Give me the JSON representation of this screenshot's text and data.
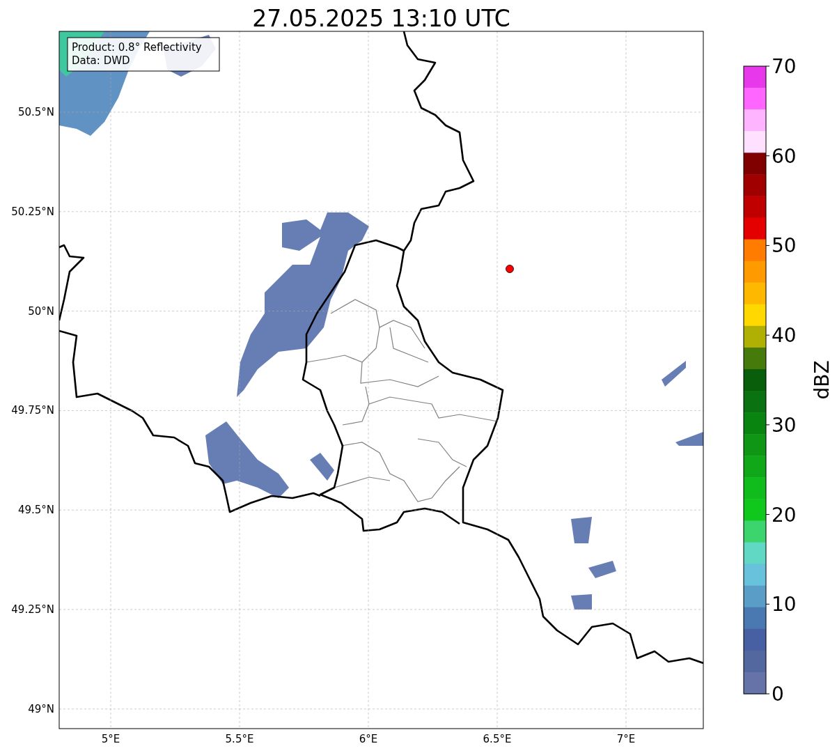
{
  "title": "27.05.2025 13:10 UTC",
  "map": {
    "x_labels": [
      "5°E",
      "5.5°E",
      "6°E",
      "6.5°E",
      "7°E"
    ],
    "y_labels": [
      "50.5°N",
      "50.25°N",
      "50°N",
      "49.75°N",
      "49.5°N",
      "49.25°N",
      "49°N"
    ]
  },
  "info_box": {
    "lines": [
      "Product: 0.8° Reflectivity",
      "Data: DWD"
    ]
  },
  "colorbar": {
    "label": "dBZ",
    "ticks": [
      "70",
      "60",
      "50",
      "40",
      "30",
      "20",
      "10",
      "0"
    ],
    "bins": [
      {
        "color": "#e838ec"
      },
      {
        "color": "#ff66ff"
      },
      {
        "color": "#ffb4ff"
      },
      {
        "color": "#ffe0ff"
      },
      {
        "color": "#800000"
      },
      {
        "color": "#a00000"
      },
      {
        "color": "#c00000"
      },
      {
        "color": "#e40000"
      },
      {
        "color": "#ff7c00"
      },
      {
        "color": "#ff9a00"
      },
      {
        "color": "#ffb800"
      },
      {
        "color": "#ffd800"
      },
      {
        "color": "#b0b004"
      },
      {
        "color": "#467a0a"
      },
      {
        "color": "#085e0a"
      },
      {
        "color": "#0a7210"
      },
      {
        "color": "#0a8410"
      },
      {
        "color": "#0e9614"
      },
      {
        "color": "#10a818"
      },
      {
        "color": "#10bc1c"
      },
      {
        "color": "#10c81c"
      },
      {
        "color": "#3cd46c"
      },
      {
        "color": "#60d8c4"
      },
      {
        "color": "#68c2dc"
      },
      {
        "color": "#5a9ec8"
      },
      {
        "color": "#4a78b0"
      },
      {
        "color": "#4660a3"
      },
      {
        "color": "#5468a0"
      },
      {
        "color": "#6673a8"
      }
    ]
  }
}
